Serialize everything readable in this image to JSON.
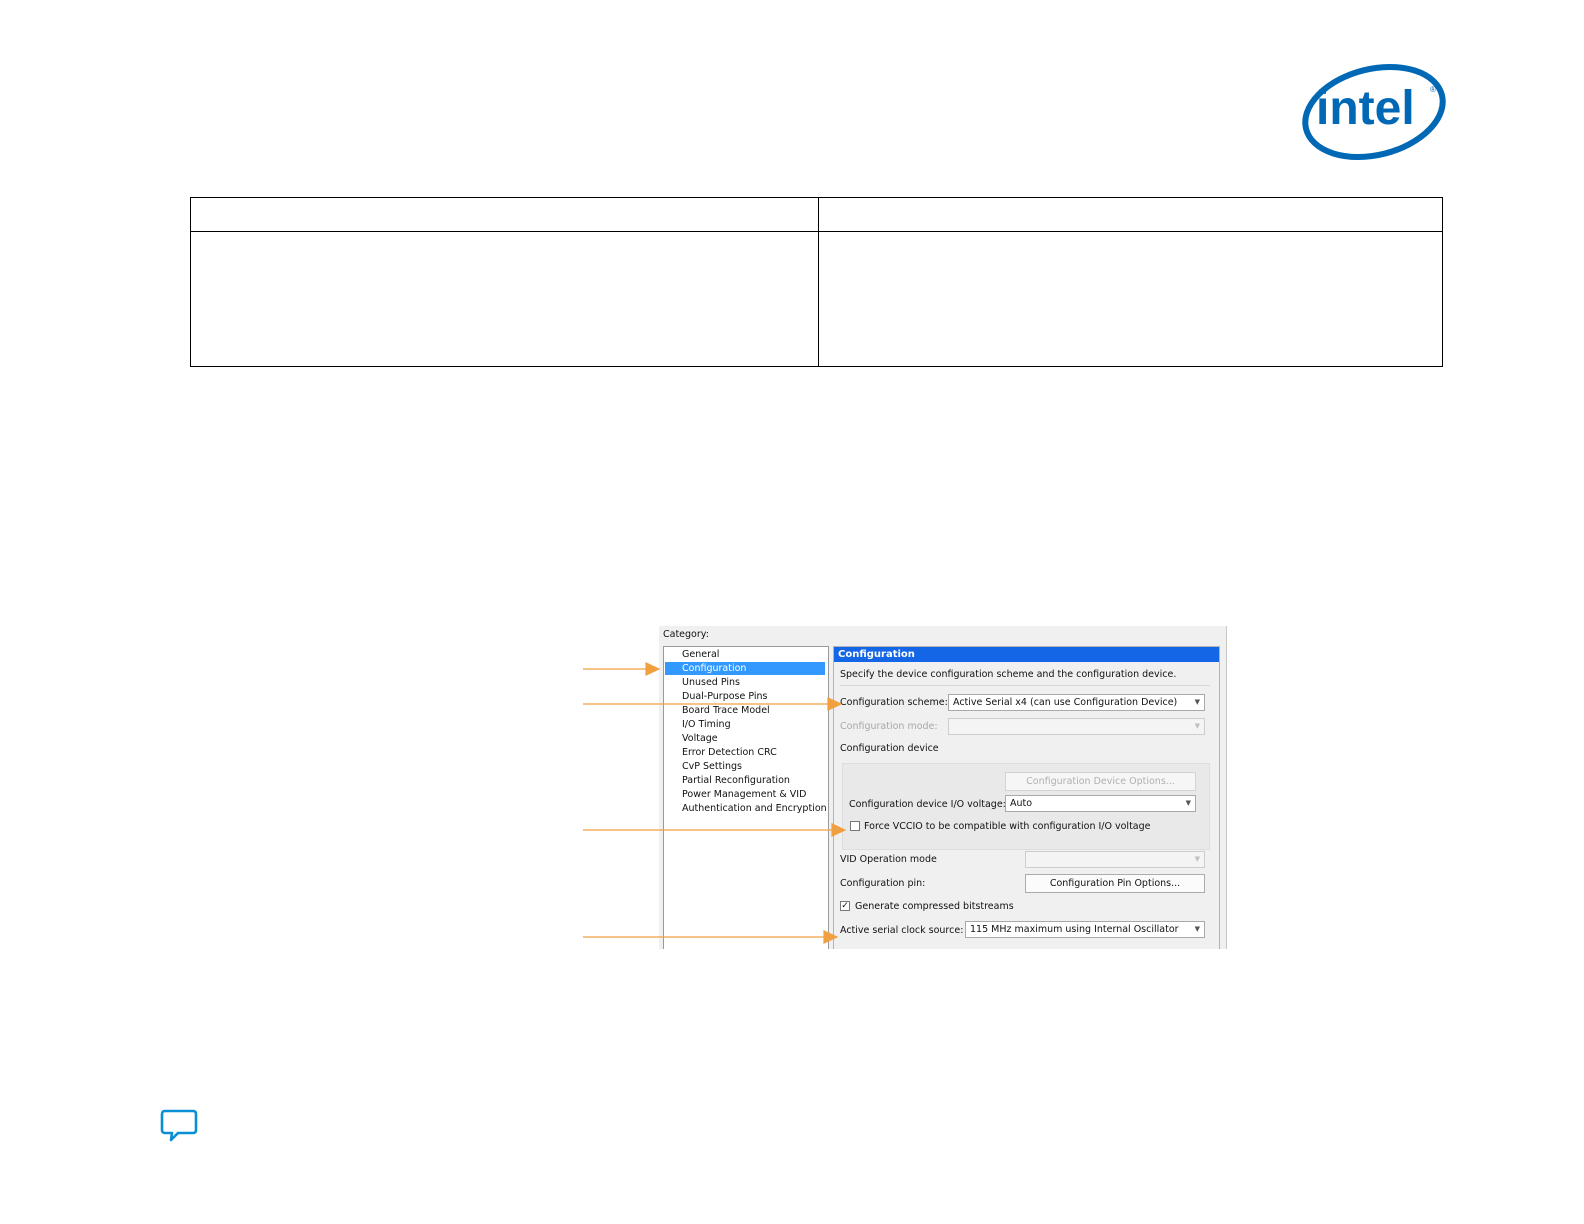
{
  "logo": {
    "text": "intel",
    "color": "#0068b5"
  },
  "colors": {
    "arrow": "#f0a040",
    "selection": "#3399ff",
    "panel_header": "#1466e6"
  },
  "dialog": {
    "category_label": "Category:",
    "categories": [
      {
        "label": "General",
        "selected": false
      },
      {
        "label": "Configuration",
        "selected": true
      },
      {
        "label": "Unused Pins",
        "selected": false
      },
      {
        "label": "Dual-Purpose Pins",
        "selected": false
      },
      {
        "label": "Board Trace Model",
        "selected": false
      },
      {
        "label": "I/O Timing",
        "selected": false
      },
      {
        "label": "Voltage",
        "selected": false
      },
      {
        "label": "Error Detection CRC",
        "selected": false
      },
      {
        "label": "CvP Settings",
        "selected": false
      },
      {
        "label": "Partial Reconfiguration",
        "selected": false
      },
      {
        "label": "Power Management & VID",
        "selected": false
      },
      {
        "label": "Authentication and Encryption",
        "selected": false
      }
    ],
    "panel": {
      "title": "Configuration",
      "description": "Specify the device configuration scheme and the configuration device.",
      "scheme_label": "Configuration scheme:",
      "scheme_value": "Active Serial x4 (can use Configuration Device)",
      "mode_label": "Configuration mode:",
      "mode_value": "",
      "device_label": "Configuration device",
      "device_options_button": "Configuration Device Options...",
      "io_voltage_label": "Configuration device I/O voltage:",
      "io_voltage_value": "Auto",
      "force_vccio_label": "Force VCCIO to be compatible with configuration I/O voltage",
      "force_vccio_checked": false,
      "vid_label": "VID Operation mode",
      "vid_value": "",
      "pin_label": "Configuration pin:",
      "pin_button": "Configuration Pin Options...",
      "compressed_label": "Generate compressed bitstreams",
      "compressed_checked": true,
      "clock_label": "Active serial clock source:",
      "clock_value": "115 MHz maximum using Internal Oscillator"
    }
  }
}
